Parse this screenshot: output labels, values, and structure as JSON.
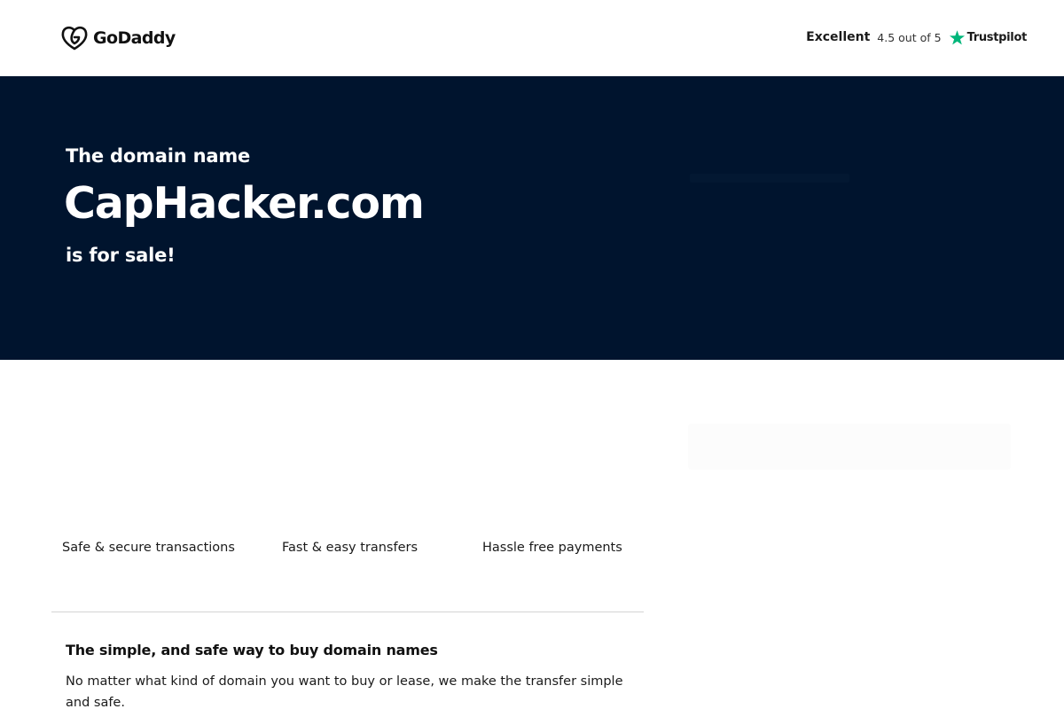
{
  "header": {
    "brand": "GoDaddy",
    "logo_icon": "godaddy-heart-logo-icon",
    "rating": {
      "label": "Excellent",
      "score_text": "4.5 out of 5",
      "provider": "Trustpilot",
      "star_icon": "trustpilot-star-icon",
      "star_color": "#00b67a"
    }
  },
  "hero": {
    "lead": "The domain name",
    "domain": "CapHacker.com",
    "tagline": "is for sale!",
    "background_color": "#00142e"
  },
  "features": [
    {
      "label": "Safe & secure transactions"
    },
    {
      "label": "Fast & easy transfers"
    },
    {
      "label": "Hassle free payments"
    }
  ],
  "info": {
    "title": "The simple, and safe way to buy domain names",
    "body": "No matter what kind of domain you want to buy or lease, we make the transfer simple and safe."
  }
}
